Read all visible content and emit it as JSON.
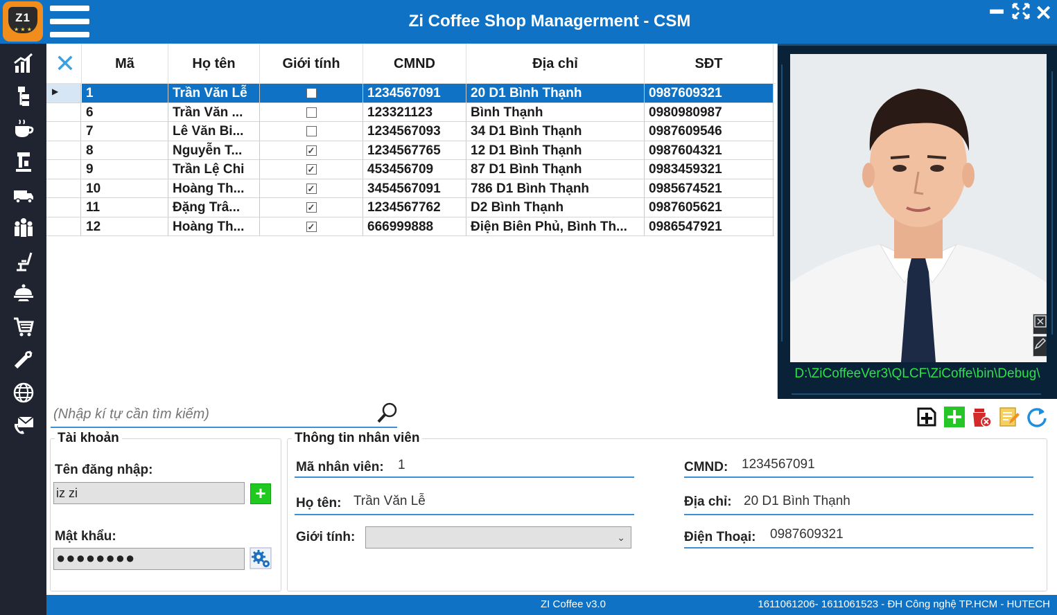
{
  "window": {
    "title": "Zi Coffee Shop Managerment - CSM",
    "logo_text": "Z1",
    "minimize": "━",
    "maximize": "✕",
    "close": "✕"
  },
  "sidebar": {
    "items": [
      {
        "name": "statistics",
        "icon": "bar-chart-icon"
      },
      {
        "name": "hierarchy",
        "icon": "hierarchy-icon"
      },
      {
        "name": "coffee",
        "icon": "coffee-cup-icon"
      },
      {
        "name": "barista",
        "icon": "coffee-machine-icon"
      },
      {
        "name": "delivery",
        "icon": "truck-icon"
      },
      {
        "name": "staff",
        "icon": "people-icon"
      },
      {
        "name": "table",
        "icon": "chair-icon"
      },
      {
        "name": "dish",
        "icon": "dish-icon"
      },
      {
        "name": "cart",
        "icon": "cart-icon"
      },
      {
        "name": "tools",
        "icon": "tools-icon"
      },
      {
        "name": "web",
        "icon": "globe-icon"
      },
      {
        "name": "contact",
        "icon": "mail-phone-icon"
      }
    ]
  },
  "grid": {
    "columns": [
      "Mã",
      "Họ tên",
      "Giới tính",
      "CMND",
      "Địa chỉ",
      "SĐT"
    ],
    "rows": [
      {
        "ma": "1",
        "hoten": "Trần Văn Lễ",
        "gioitinh": false,
        "cmnd": "1234567091",
        "diachi": "20 D1 Bình Thạnh",
        "sdt": "0987609321",
        "selected": true
      },
      {
        "ma": "6",
        "hoten": "Trần Văn ...",
        "gioitinh": false,
        "cmnd": "123321123",
        "diachi": "Bình Thạnh",
        "sdt": "0980980987",
        "selected": false
      },
      {
        "ma": "7",
        "hoten": "Lê Văn Bi...",
        "gioitinh": false,
        "cmnd": "1234567093",
        "diachi": "34 D1 Bình Thạnh",
        "sdt": "0987609546",
        "selected": false
      },
      {
        "ma": "8",
        "hoten": "Nguyễn T...",
        "gioitinh": true,
        "cmnd": "1234567765",
        "diachi": "12 D1 Bình Thạnh",
        "sdt": "0987604321",
        "selected": false
      },
      {
        "ma": "9",
        "hoten": "Trần Lệ Chi",
        "gioitinh": true,
        "cmnd": "453456709",
        "diachi": "87 D1 Bình Thạnh",
        "sdt": "0983459321",
        "selected": false
      },
      {
        "ma": "10",
        "hoten": "Hoàng Th...",
        "gioitinh": true,
        "cmnd": "3454567091",
        "diachi": "786 D1 Bình Thạnh",
        "sdt": "0985674521",
        "selected": false
      },
      {
        "ma": "11",
        "hoten": "Đặng Trâ...",
        "gioitinh": true,
        "cmnd": "1234567762",
        "diachi": "D2 Bình Thạnh",
        "sdt": "0987605621",
        "selected": false
      },
      {
        "ma": "12",
        "hoten": "Hoàng Th...",
        "gioitinh": true,
        "cmnd": "666999888",
        "diachi": "Điện Biên Phủ, Bình Th...",
        "sdt": "0986547921",
        "selected": false
      }
    ]
  },
  "photo": {
    "path": "D:\\ZiCoffeeVer3\\QLCF\\ZiCoffe\\bin\\Debug\\"
  },
  "search": {
    "placeholder": "(Nhập kí tự cần tìm kiếm)"
  },
  "account": {
    "legend": "Tài khoản",
    "username_label": "Tên đăng nhập:",
    "username": "iz zi",
    "password_label": "Mật khẩu:",
    "password": "●●●●●●●●",
    "add_label": "+"
  },
  "employee": {
    "legend": "Thông tin nhân viên",
    "id_label": "Mã nhân viên:",
    "id": "1",
    "name_label": "Họ tên:",
    "name": "Trần Văn Lễ",
    "gender_label": "Giới tính:",
    "gender": "",
    "cmnd_label": "CMND:",
    "cmnd": "1234567091",
    "address_label": "Địa chỉ:",
    "address": "20 D1 Bình Thạnh",
    "phone_label": "Điện Thoại:",
    "phone": "0987609321"
  },
  "status": {
    "version": "ZI Coffee v3.0",
    "credit": "1611061206- 1611061523 - ĐH Công nghệ TP.HCM - HUTECH"
  },
  "colors": {
    "accent": "#0f72c4",
    "sidebar": "#1f2430",
    "path_text": "#2ee04a"
  }
}
